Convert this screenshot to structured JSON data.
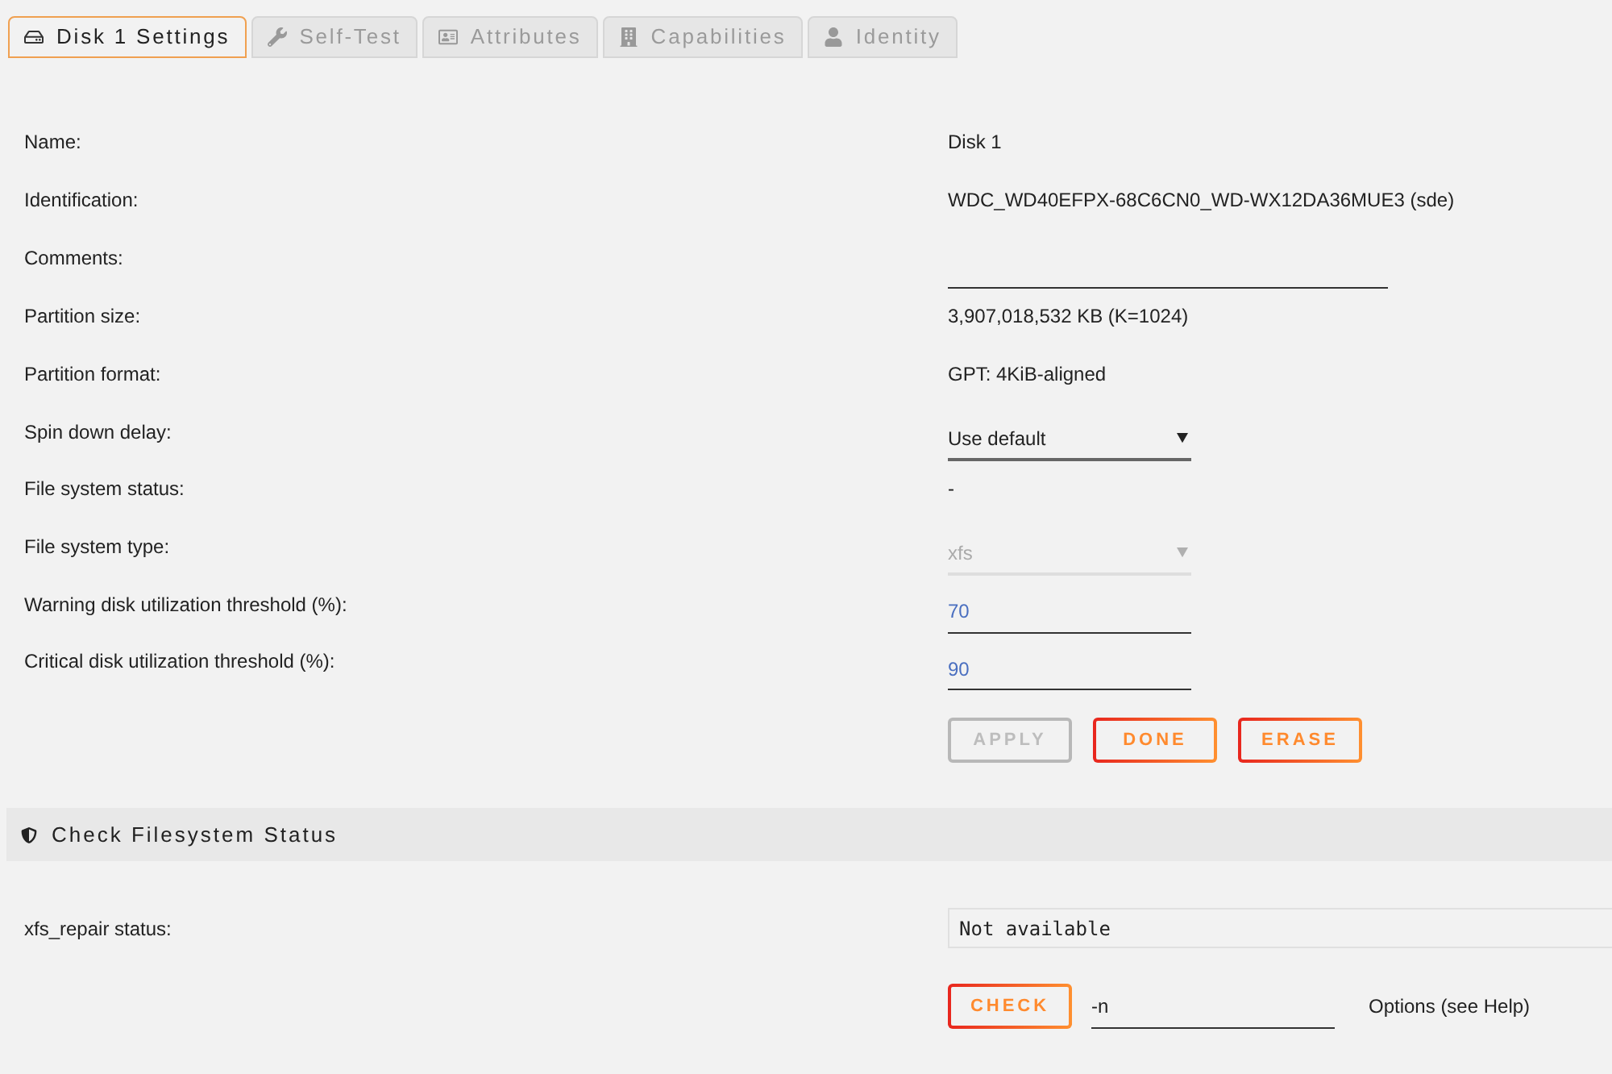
{
  "tabs": [
    {
      "label": "Disk 1 Settings",
      "selected": true
    },
    {
      "label": "Self-Test",
      "selected": false
    },
    {
      "label": "Attributes",
      "selected": false
    },
    {
      "label": "Capabilities",
      "selected": false
    },
    {
      "label": "Identity",
      "selected": false
    }
  ],
  "settings": [
    {
      "label": "Name:",
      "kind": "text",
      "value": "Disk 1"
    },
    {
      "label": "Identification:",
      "kind": "text",
      "value": "WDC_WD40EFPX-68C6CN0_WD-WX12DA36MUE3 (sde)"
    },
    {
      "label": "Comments:",
      "kind": "text_input"
    },
    {
      "label": "Partition size:",
      "kind": "text",
      "value": "3,907,018,532 KB (K=1024)"
    },
    {
      "label": "Partition format:",
      "kind": "text",
      "value": "GPT: 4KiB-aligned"
    },
    {
      "label": "Spin down delay:",
      "kind": "select",
      "value": "Use default",
      "disabled": false
    },
    {
      "label": "File system status:",
      "kind": "text",
      "value": "-"
    },
    {
      "label": "File system type:",
      "kind": "select",
      "value": "xfs",
      "disabled": true
    },
    {
      "label": "Warning disk utilization threshold (%):",
      "kind": "number_input",
      "value": "70"
    },
    {
      "label": "Critical disk utilization threshold (%):",
      "kind": "number_input",
      "value": "90"
    }
  ],
  "buttons": [
    {
      "label": "APPLY",
      "disabled": true
    },
    {
      "label": "DONE",
      "disabled": false
    },
    {
      "label": "ERASE",
      "disabled": false
    }
  ],
  "check_filesystem": {
    "title": "Check Filesystem Status",
    "status_label": "xfs_repair status:",
    "status_value": "Not available",
    "check_button": "CHECK",
    "options_value": "-n",
    "options_hint": "Options (see Help)"
  }
}
